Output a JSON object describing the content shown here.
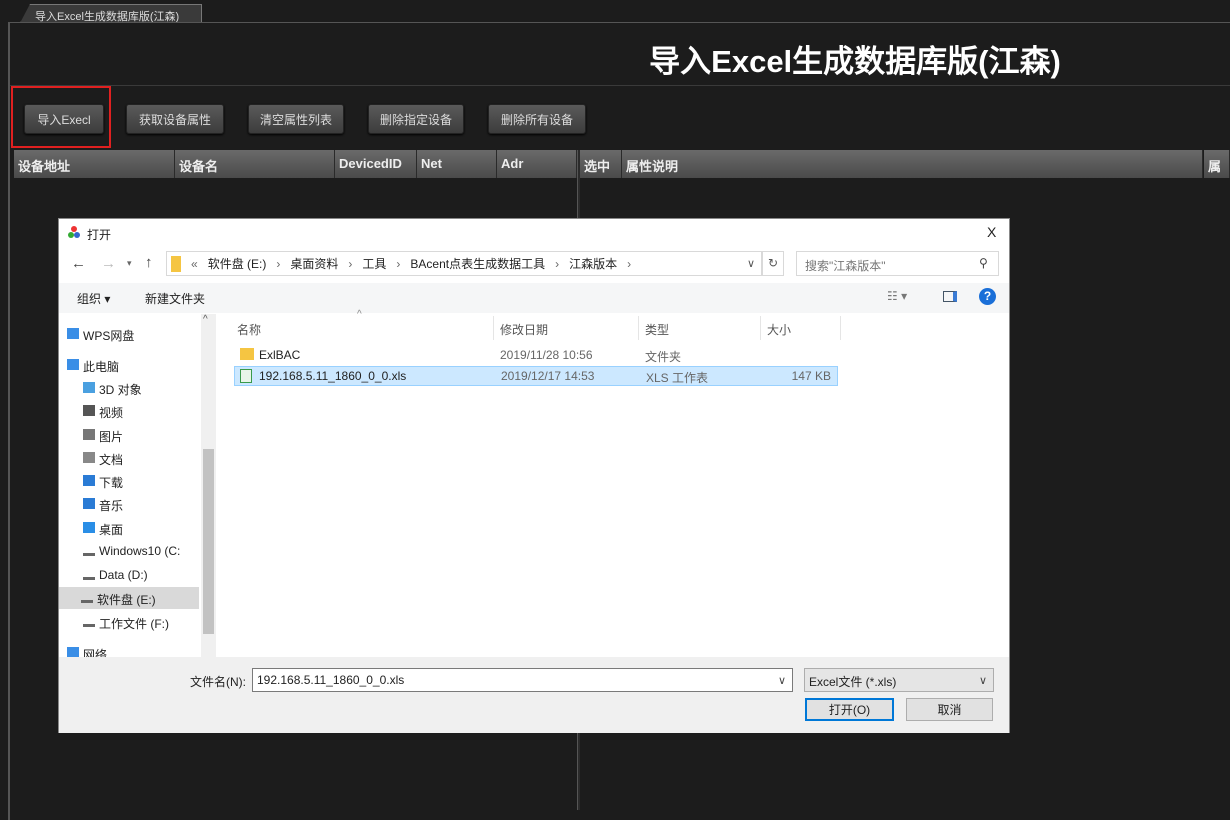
{
  "app": {
    "tab_label": "导入Excel生成数据库版(江森)",
    "title": "导入Excel生成数据库版(江森)",
    "highlight_color": "#e02020"
  },
  "toolbar": {
    "buttons": [
      "导入Execl",
      "获取设备属性",
      "清空属性列表",
      "删除指定设备",
      "删除所有设备"
    ]
  },
  "device_table": {
    "columns": [
      "设备地址",
      "设备名",
      "DevicedID",
      "Net",
      "Adr"
    ]
  },
  "property_table": {
    "columns": [
      "选中",
      "属性说明",
      "属"
    ]
  },
  "dialog": {
    "title": "打开",
    "close": "X",
    "breadcrumb": [
      "«",
      "软件盘 (E:)",
      "桌面资料",
      "工具",
      "BAcent点表生成数据工具",
      "江森版本"
    ],
    "search_placeholder": "搜索\"江森版本\"",
    "organize": "组织 ▾",
    "new_folder": "新建文件夹",
    "nav": [
      {
        "label": "WPS网盘",
        "icon": "cloud-icon"
      },
      {
        "label": "此电脑",
        "icon": "computer-icon"
      },
      {
        "label": "3D 对象",
        "icon": "cube-icon"
      },
      {
        "label": "视频",
        "icon": "video-icon"
      },
      {
        "label": "图片",
        "icon": "picture-icon"
      },
      {
        "label": "文档",
        "icon": "document-icon"
      },
      {
        "label": "下载",
        "icon": "download-icon"
      },
      {
        "label": "音乐",
        "icon": "music-icon"
      },
      {
        "label": "桌面",
        "icon": "desktop-icon"
      },
      {
        "label": "Windows10 (C:",
        "icon": "drive-icon"
      },
      {
        "label": "Data (D:)",
        "icon": "drive-icon"
      },
      {
        "label": "软件盘 (E:)",
        "icon": "drive-icon",
        "selected": true
      },
      {
        "label": "工作文件 (F:)",
        "icon": "drive-icon"
      },
      {
        "label": "网络",
        "icon": "network-icon"
      }
    ],
    "columns": [
      "名称",
      "修改日期",
      "类型",
      "大小"
    ],
    "files": [
      {
        "name": "ExlBAC",
        "date": "2019/11/28 10:56",
        "type": "文件夹",
        "size": "",
        "icon": "folder-icon"
      },
      {
        "name": "192.168.5.11_1860_0_0.xls",
        "date": "2019/12/17 14:53",
        "type": "XLS 工作表",
        "size": "147 KB",
        "icon": "excel-file-icon",
        "selected": true
      }
    ],
    "filename_label": "文件名(N):",
    "filename_value": "192.168.5.11_1860_0_0.xls",
    "filter": "Excel文件 (*.xls)",
    "open": "打开(O)",
    "cancel": "取消"
  }
}
